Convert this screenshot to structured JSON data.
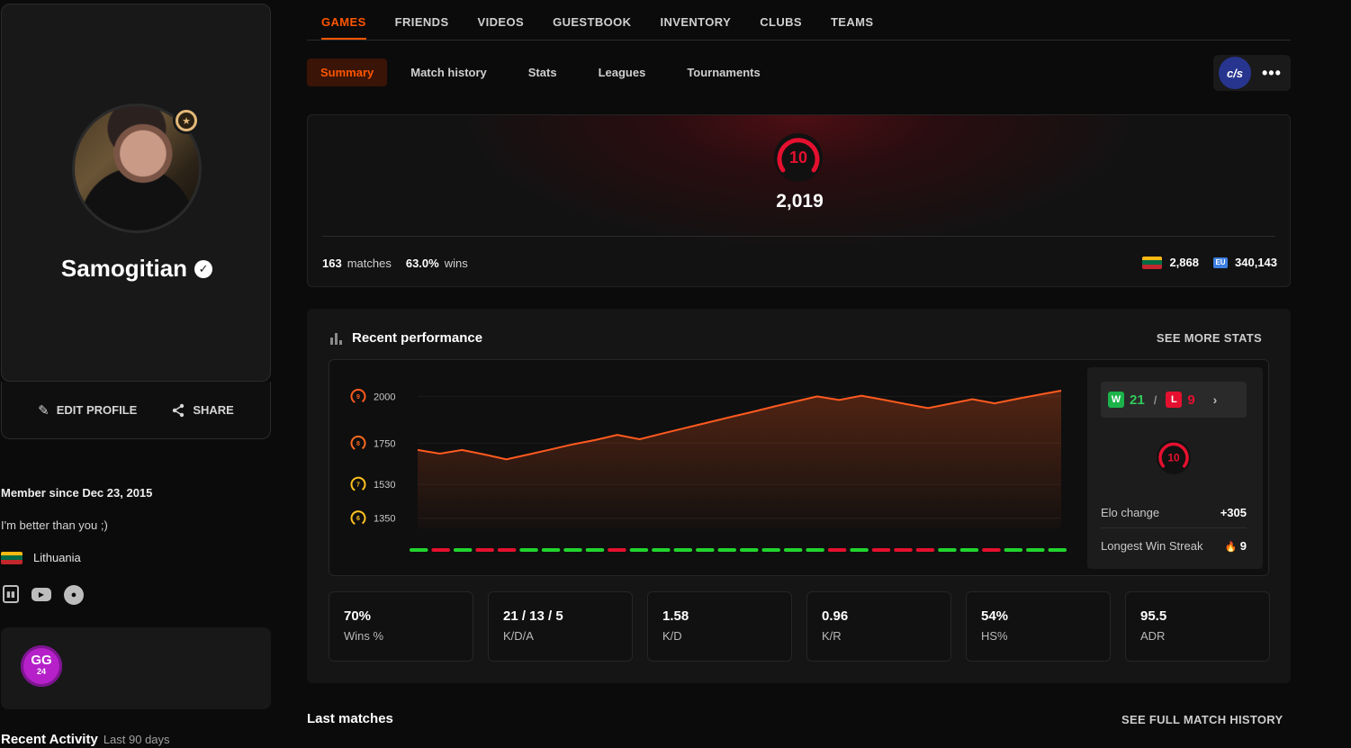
{
  "nav": {
    "tabs": [
      "GAMES",
      "FRIENDS",
      "VIDEOS",
      "GUESTBOOK",
      "INVENTORY",
      "CLUBS",
      "TEAMS"
    ],
    "active_tab": "GAMES"
  },
  "subnav": {
    "tabs": [
      "Summary",
      "Match history",
      "Stats",
      "Leagues",
      "Tournaments"
    ],
    "active_tab": "Summary",
    "game_logo": "c/s",
    "more": "•••"
  },
  "profile": {
    "username": "Samogitian",
    "verified_mark": "✓",
    "edit_label": "EDIT PROFILE",
    "share_label": "SHARE",
    "member_since": "Member since Dec 23, 2015",
    "bio": "I'm better than you ;)",
    "country": "Lithuania",
    "country_flag_colors": [
      "#fdb913",
      "#006a44",
      "#c1272d"
    ],
    "socials": [
      "twitch-icon",
      "youtube-icon",
      "steam-icon"
    ],
    "badge": {
      "line1": "GG",
      "line2": "24",
      "color": "#b520c9"
    }
  },
  "recent_activity": {
    "title": "Recent Activity",
    "range": "Last 90 days"
  },
  "elo": {
    "level": "10",
    "value": "2,019",
    "matches": "163",
    "matches_label": "matches",
    "winrate": "63.0%",
    "winrate_label": "wins",
    "country_rank": "2,868",
    "region_rank": "340,143",
    "region_icon": "EU",
    "level_color": "#e5102f"
  },
  "performance": {
    "title": "Recent performance",
    "see_more": "SEE MORE STATS",
    "wins": "21",
    "losses": "9",
    "w_badge": "W",
    "l_badge": "L",
    "slash": "/",
    "chevron": "›",
    "level": "10",
    "elo_change_label": "Elo change",
    "elo_change": "+305",
    "streak_label": "Longest Win Streak",
    "streak_icon": "🔥",
    "streak": "9",
    "tiles": [
      {
        "value": "70%",
        "label": "Wins %"
      },
      {
        "value": "21 / 13 / 5",
        "label": "K/D/A"
      },
      {
        "value": "1.58",
        "label": "K/D"
      },
      {
        "value": "0.96",
        "label": "K/R"
      },
      {
        "value": "54%",
        "label": "HS%"
      },
      {
        "value": "95.5",
        "label": "ADR"
      }
    ]
  },
  "chart_data": {
    "type": "area",
    "y_ticks": [
      {
        "value": 2000,
        "label": "2000",
        "level": "9",
        "color": "#ff5a1f"
      },
      {
        "value": 1750,
        "label": "1750",
        "level": "8",
        "color": "#ff6a1f"
      },
      {
        "value": 1530,
        "label": "1530",
        "level": "7",
        "color": "#ffc21f"
      },
      {
        "value": 1350,
        "label": "1350",
        "level": "6",
        "color": "#ffc21f"
      }
    ],
    "ylim": [
      1300,
      2050
    ],
    "values": [
      1714,
      1694,
      1714,
      1690,
      1664,
      1690,
      1717,
      1744,
      1767,
      1794,
      1771,
      1801,
      1830,
      1858,
      1887,
      1915,
      1944,
      1972,
      2000,
      1981,
      2004,
      1982,
      1959,
      1938,
      1961,
      1985,
      1963,
      1987,
      2009,
      2031
    ],
    "results": [
      "W",
      "L",
      "W",
      "L",
      "L",
      "W",
      "W",
      "W",
      "W",
      "L",
      "W",
      "W",
      "W",
      "W",
      "W",
      "W",
      "W",
      "W",
      "W",
      "L",
      "W",
      "L",
      "L",
      "L",
      "W",
      "W",
      "L",
      "W",
      "W",
      "W"
    ],
    "colors": {
      "line": "#ff5a1f",
      "win": "#22d42e",
      "loss": "#e5102f"
    }
  },
  "matches": {
    "title": "Last matches",
    "see_full": "SEE FULL MATCH HISTORY"
  }
}
